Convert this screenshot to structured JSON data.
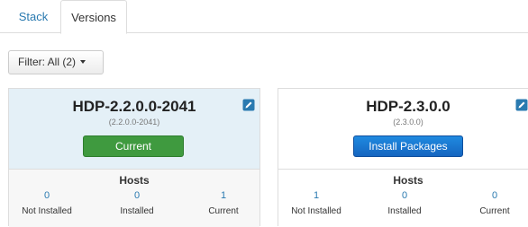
{
  "tabs": [
    {
      "label": "Stack",
      "active": false
    },
    {
      "label": "Versions",
      "active": true
    }
  ],
  "filter": {
    "label": "Filter: All (2)"
  },
  "colors": {
    "link": "#2a7ab0",
    "current_button": "#3f9a3f",
    "install_button": "#1a78d4",
    "selected_card_bg": "#e4f0f7"
  },
  "versions": [
    {
      "title": "HDP-2.2.0.0-2041",
      "subtitle": "(2.2.0.0-2041)",
      "action": "Current",
      "hosts_label": "Hosts",
      "stats": [
        {
          "value": "0",
          "label": "Not Installed"
        },
        {
          "value": "0",
          "label": "Installed"
        },
        {
          "value": "1",
          "label": "Current"
        }
      ]
    },
    {
      "title": "HDP-2.3.0.0",
      "subtitle": "(2.3.0.0)",
      "action": "Install Packages",
      "hosts_label": "Hosts",
      "stats": [
        {
          "value": "1",
          "label": "Not Installed"
        },
        {
          "value": "0",
          "label": "Installed"
        },
        {
          "value": "0",
          "label": "Current"
        }
      ]
    }
  ]
}
